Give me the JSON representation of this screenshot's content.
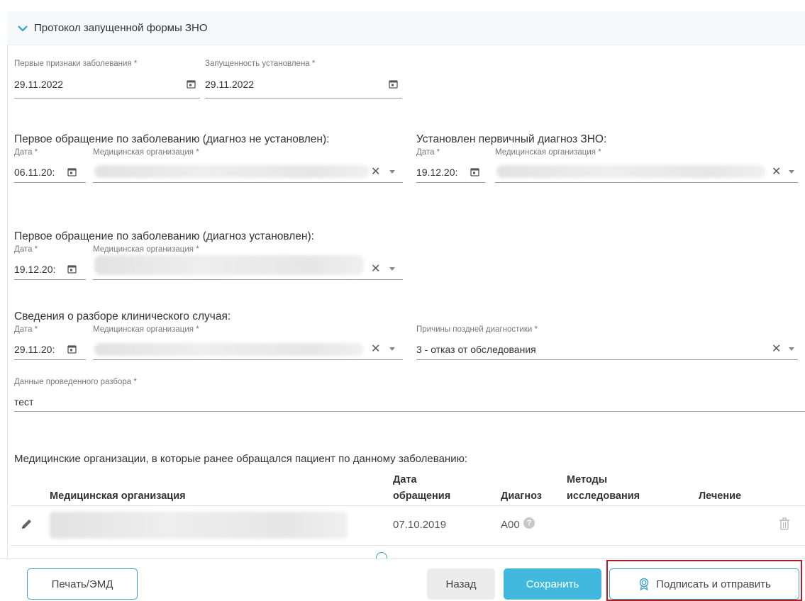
{
  "section": {
    "title": "Протокол запущенной формы ЗНО"
  },
  "first_signs": {
    "label": "Первые признаки заболевания *",
    "value": "29.11.2022"
  },
  "neglect_established": {
    "label": "Запущенность установлена *",
    "value": "29.11.2022"
  },
  "first_visit_no_dx": {
    "title": "Первое обращение по заболеванию (диагноз не установлен):",
    "date_label": "Дата *",
    "date_value": "06.11.20:",
    "org_label": "Медицинская организация *"
  },
  "primary_dx": {
    "title": "Установлен первичный диагноз ЗНО:",
    "date_label": "Дата *",
    "date_value": "19.12.20:",
    "org_label": "Медицинская организация *"
  },
  "first_visit_dx": {
    "title": "Первое обращение по заболеванию (диагноз установлен):",
    "date_label": "Дата *",
    "date_value": "19.12.20:",
    "org_label": "Медицинская организация *"
  },
  "clinical_review": {
    "title": "Сведения о разборе клинического случая:",
    "date_label": "Дата *",
    "date_value": "29.11.20:",
    "org_label": "Медицинская организация *",
    "reason_label": "Причины поздней диагностики *",
    "reason_value": "3 - отказ от обследования"
  },
  "review_data": {
    "label": "Данные проведенного разбора *",
    "value": "тест"
  },
  "table": {
    "title": "Медицинские организации, в которые ранее обращался пациент по данному заболеванию:",
    "headers": {
      "org": "Медицинская организация",
      "date_1": "Дата",
      "date_2": "обращения",
      "diagnosis": "Диагноз",
      "methods_1": "Методы",
      "methods_2": "исследования",
      "treatment": "Лечение"
    },
    "rows": [
      {
        "date": "07.10.2019",
        "diagnosis": "A00"
      }
    ]
  },
  "footer": {
    "print": "Печать/ЭМД",
    "back": "Назад",
    "save": "Сохранить",
    "sign_send": "Подписать и отправить"
  },
  "colors": {
    "accent": "#41b8de",
    "highlight": "#b01d22",
    "chevron": "#2aa0d6"
  },
  "icons": {
    "calendar": "calendar-icon",
    "clear": "close-icon",
    "dropdown": "chevron-down-icon",
    "edit": "pencil-icon",
    "delete": "trash-icon",
    "help": "help-icon",
    "sign": "certificate-icon"
  }
}
